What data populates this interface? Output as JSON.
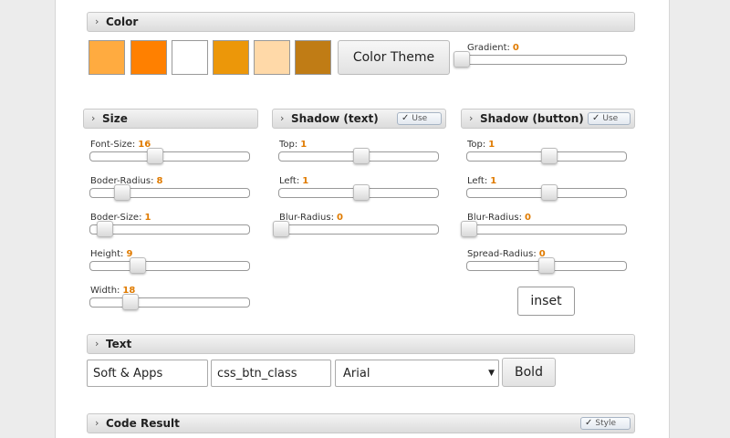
{
  "color": {
    "title": "Color",
    "swatches": [
      "#ffab40",
      "#ff8000",
      "#ffffff",
      "#ec9709",
      "#ffd9a8",
      "#c07c15"
    ],
    "theme_button": "Color Theme",
    "gradient": {
      "label": "Gradient:",
      "value": "0",
      "fraction": 0
    }
  },
  "size": {
    "title": "Size",
    "sliders": [
      {
        "label": "Font-Size:",
        "value": "16",
        "fraction": 0.41
      },
      {
        "label": "Boder-Radius:",
        "value": "8",
        "fraction": 0.2
      },
      {
        "label": "Boder-Size:",
        "value": "1",
        "fraction": 0.09
      },
      {
        "label": "Height:",
        "value": "9",
        "fraction": 0.3
      },
      {
        "label": "Width:",
        "value": "18",
        "fraction": 0.25
      }
    ]
  },
  "shadow_text": {
    "title": "Shadow (text)",
    "use_label": "Use",
    "sliders": [
      {
        "label": "Top:",
        "value": "1",
        "fraction": 0.52
      },
      {
        "label": "Left:",
        "value": "1",
        "fraction": 0.52
      },
      {
        "label": "Blur-Radius:",
        "value": "0",
        "fraction": 0.01
      }
    ]
  },
  "shadow_button": {
    "title": "Shadow (button)",
    "use_label": "Use",
    "sliders": [
      {
        "label": "Top:",
        "value": "1",
        "fraction": 0.52
      },
      {
        "label": "Left:",
        "value": "1",
        "fraction": 0.52
      },
      {
        "label": "Blur-Radius:",
        "value": "0",
        "fraction": 0.01
      },
      {
        "label": "Spread-Radius:",
        "value": "0",
        "fraction": 0.5
      }
    ],
    "inset_button": "inset"
  },
  "text": {
    "title": "Text",
    "text_input": "Soft & Apps",
    "class_input": "css_btn_class",
    "font_select": "Arial",
    "bold_button": "Bold"
  },
  "code_result": {
    "title": "Code Result",
    "style_label": "Style"
  },
  "icons": {
    "chevron": "›",
    "check": "✓",
    "dropdown": "▼"
  }
}
